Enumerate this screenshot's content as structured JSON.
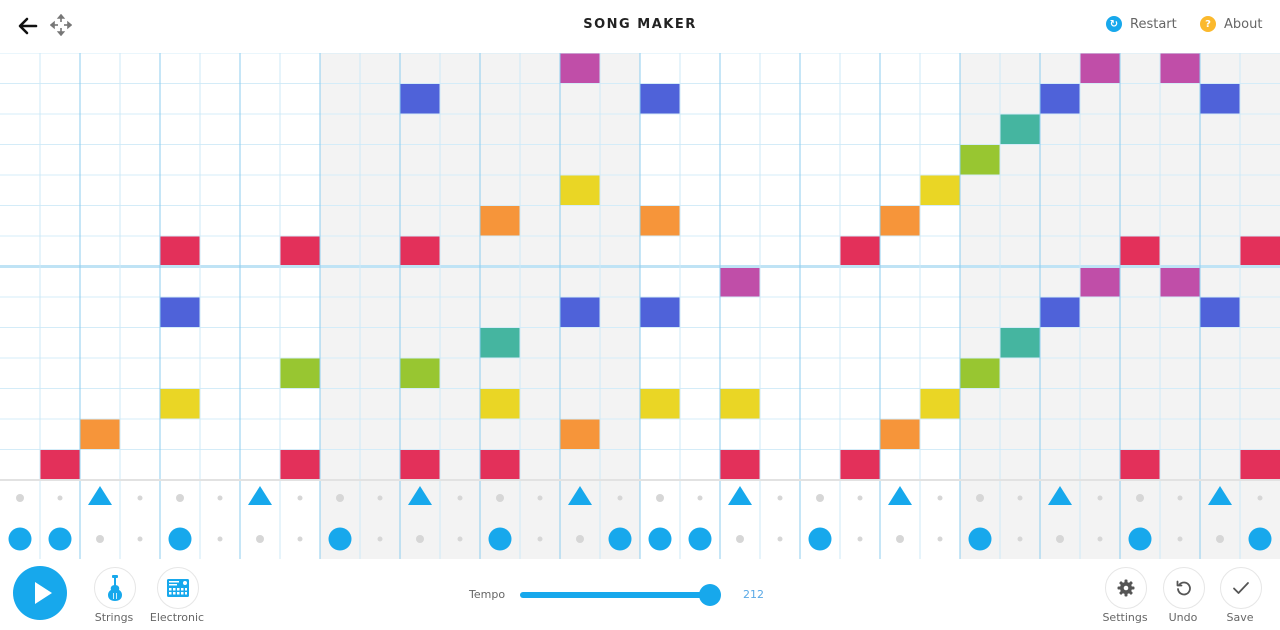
{
  "header": {
    "title": "SONG MAKER",
    "restart_label": "Restart",
    "about_label": "About",
    "restart_icon": "restart-icon",
    "about_icon": "question-icon",
    "back_icon": "arrow-left-icon",
    "move_icon": "move-arrows-icon"
  },
  "grid": {
    "columns": 32,
    "rows": 14,
    "beats_per_bar": 8,
    "shaded_bars": [
      1,
      3
    ],
    "row_colors": [
      "#c04ea8",
      "#4f62d9",
      "#45b5a0",
      "#98c631",
      "#ead625",
      "#f6953a",
      "#e3305a",
      "#c04ea8",
      "#4f62d9",
      "#45b5a0",
      "#98c631",
      "#ead625",
      "#f6953a",
      "#e3305a"
    ],
    "notes": [
      {
        "row": 0,
        "col": 14
      },
      {
        "row": 0,
        "col": 27
      },
      {
        "row": 0,
        "col": 29
      },
      {
        "row": 1,
        "col": 10
      },
      {
        "row": 1,
        "col": 16
      },
      {
        "row": 1,
        "col": 26
      },
      {
        "row": 1,
        "col": 30
      },
      {
        "row": 2,
        "col": 25
      },
      {
        "row": 3,
        "col": 24
      },
      {
        "row": 4,
        "col": 14
      },
      {
        "row": 4,
        "col": 23
      },
      {
        "row": 5,
        "col": 12
      },
      {
        "row": 5,
        "col": 16
      },
      {
        "row": 5,
        "col": 22
      },
      {
        "row": 6,
        "col": 4
      },
      {
        "row": 6,
        "col": 7
      },
      {
        "row": 6,
        "col": 10
      },
      {
        "row": 6,
        "col": 21
      },
      {
        "row": 6,
        "col": 28
      },
      {
        "row": 6,
        "col": 31
      },
      {
        "row": 7,
        "col": 18
      },
      {
        "row": 7,
        "col": 27
      },
      {
        "row": 7,
        "col": 29
      },
      {
        "row": 8,
        "col": 4
      },
      {
        "row": 8,
        "col": 14
      },
      {
        "row": 8,
        "col": 16
      },
      {
        "row": 8,
        "col": 26
      },
      {
        "row": 8,
        "col": 30
      },
      {
        "row": 9,
        "col": 12
      },
      {
        "row": 9,
        "col": 25
      },
      {
        "row": 10,
        "col": 7
      },
      {
        "row": 10,
        "col": 10
      },
      {
        "row": 10,
        "col": 24
      },
      {
        "row": 11,
        "col": 4
      },
      {
        "row": 11,
        "col": 12
      },
      {
        "row": 11,
        "col": 16
      },
      {
        "row": 11,
        "col": 18
      },
      {
        "row": 11,
        "col": 23
      },
      {
        "row": 12,
        "col": 2
      },
      {
        "row": 12,
        "col": 14
      },
      {
        "row": 12,
        "col": 22
      },
      {
        "row": 13,
        "col": 1
      },
      {
        "row": 13,
        "col": 7
      },
      {
        "row": 13,
        "col": 10
      },
      {
        "row": 13,
        "col": 12
      },
      {
        "row": 13,
        "col": 18
      },
      {
        "row": 13,
        "col": 21
      },
      {
        "row": 13,
        "col": 28
      },
      {
        "row": 13,
        "col": 31
      }
    ]
  },
  "percussion": {
    "accent_color": "#17a8ec",
    "triangle_cols": [
      2,
      6,
      10,
      14,
      18,
      22,
      26,
      30
    ],
    "circle_cols": [
      0,
      1,
      4,
      8,
      12,
      15,
      16,
      17,
      20,
      24,
      28,
      31
    ]
  },
  "bottom": {
    "play_icon": "play-icon",
    "instrument_label": "Strings",
    "instrument_icon": "violin-icon",
    "percussion_label": "Electronic",
    "percussion_icon": "drum-machine-icon",
    "tempo_label": "Tempo",
    "tempo_value": "212",
    "tempo_fraction": 0.95,
    "settings_label": "Settings",
    "undo_label": "Undo",
    "save_label": "Save"
  }
}
